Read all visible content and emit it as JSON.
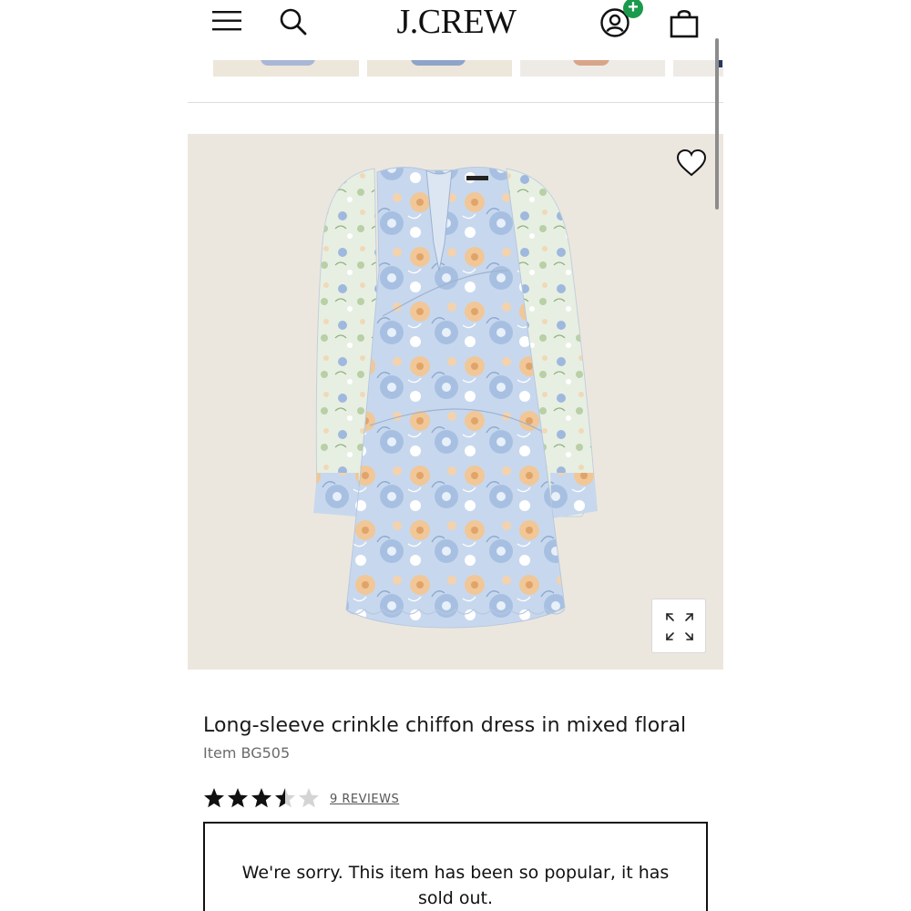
{
  "header": {
    "logo": "J.CREW",
    "menu_icon": "hamburger-menu-icon",
    "search_icon": "search-icon",
    "account_icon": "account-icon",
    "account_badge": "+",
    "bag_icon": "shopping-bag-icon"
  },
  "thumbnails": [
    {
      "peek_color": "#a9b6d6"
    },
    {
      "peek_color": "#8ea4c8"
    },
    {
      "peek_color": "#d8a58a"
    },
    {
      "peek_color": "#2a3560"
    }
  ],
  "product": {
    "image_alt": "dress-image",
    "wishlist_icon": "heart-icon",
    "expand_icon": "expand-icon",
    "title": "Long-sleeve crinkle chiffon dress in mixed floral",
    "item_number": "Item BG505",
    "rating": 3.5,
    "rating_max": 5,
    "reviews_label": "9 REVIEWS",
    "soldout_message": "We're sorry. This item has been so popular, it has sold out."
  },
  "colors": {
    "accent_green": "#1a9a4c",
    "image_background": "#ece7de",
    "dress_blue": "#b9cde6",
    "dress_peach": "#f0c495"
  }
}
